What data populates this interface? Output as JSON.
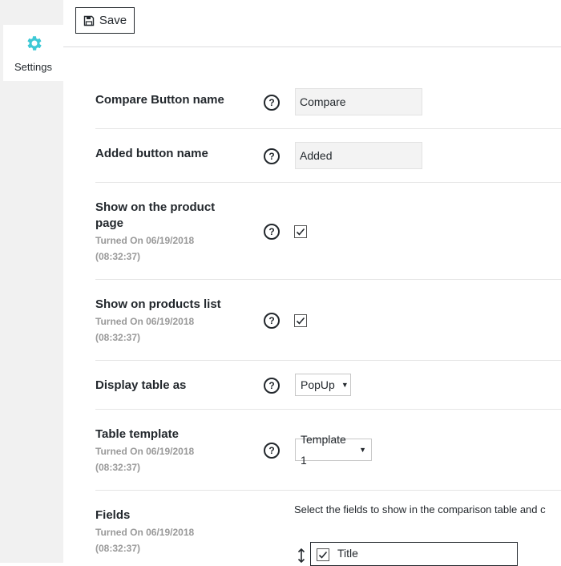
{
  "sidebar": {
    "tabs": [
      {
        "label": "Settings",
        "icon": "gear-icon",
        "color": "#3ec9d6"
      }
    ]
  },
  "toolbar": {
    "save_label": "Save",
    "save_icon": "floppy-disk-icon"
  },
  "settings": {
    "compare_button_name": {
      "label": "Compare Button name",
      "value": "Compare"
    },
    "added_button_name": {
      "label": "Added button name",
      "value": "Added"
    },
    "show_on_product_page": {
      "label_line1": "Show on the product",
      "label_line2": "page",
      "sub_line1": "Turned On 06/19/2018",
      "sub_line2": "(08:32:37)",
      "checked": true
    },
    "show_on_products_list": {
      "label": "Show on products list",
      "sub_line1": "Turned On 06/19/2018",
      "sub_line2": "(08:32:37)",
      "checked": true
    },
    "display_table_as": {
      "label": "Display table as",
      "value": "PopUp"
    },
    "table_template": {
      "label": "Table template",
      "sub_line1": "Turned On 06/19/2018",
      "sub_line2": "(08:32:37)",
      "value": "Template 1"
    },
    "fields": {
      "label": "Fields",
      "sub_line1": "Turned On 06/19/2018",
      "sub_line2": "(08:32:37)",
      "description": "Select the fields to show in the comparison table and c",
      "items": [
        {
          "label": "Title",
          "checked": true
        }
      ]
    }
  },
  "help_glyph": "?"
}
